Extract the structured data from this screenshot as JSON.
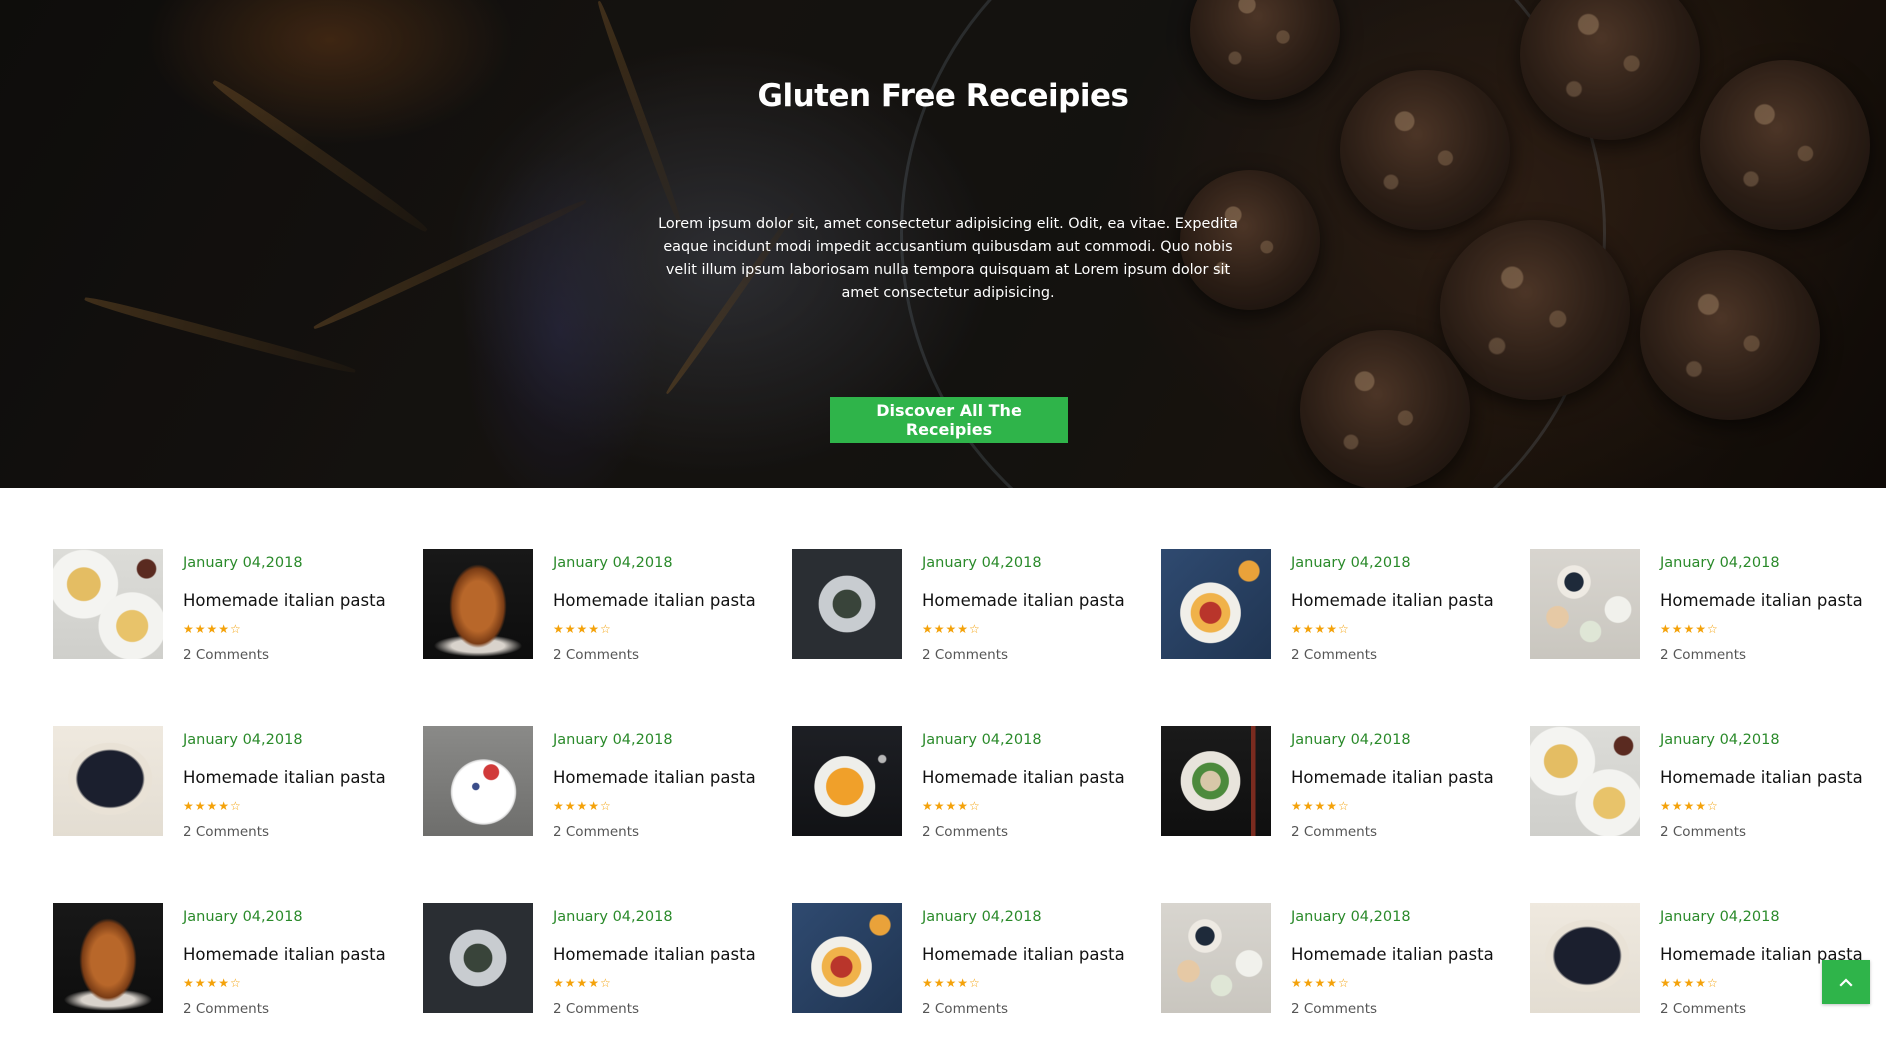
{
  "hero": {
    "title": "Gluten Free Receipies",
    "description": "Lorem ipsum dolor sit, amet consectetur adipisicing elit. Odit, ea vitae. Expedita eaque incidunt modi impedit accusantium quibusdam aut commodi. Quo nobis velit illum ipsum laboriosam nulla tempora quisquam at Lorem ipsum dolor sit amet consectetur adipisicing.",
    "button_label": "Discover All The Receipies"
  },
  "recipes": [
    {
      "date": "January 04,2018",
      "title": "Homemade italian pasta",
      "stars": "★★★★☆",
      "rating": 4,
      "comments": "2 Comments",
      "image": "pasta-plates"
    },
    {
      "date": "January 04,2018",
      "title": "Homemade italian pasta",
      "stars": "★★★★☆",
      "rating": 4,
      "comments": "2 Comments",
      "image": "panettone"
    },
    {
      "date": "January 04,2018",
      "title": "Homemade italian pasta",
      "stars": "★★★★☆",
      "rating": 4,
      "comments": "2 Comments",
      "image": "mussels"
    },
    {
      "date": "January 04,2018",
      "title": "Homemade italian pasta",
      "stars": "★★★★☆",
      "rating": 4,
      "comments": "2 Comments",
      "image": "fruit-bowl"
    },
    {
      "date": "January 04,2018",
      "title": "Homemade italian pasta",
      "stars": "★★★★☆",
      "rating": 4,
      "comments": "2 Comments",
      "image": "macarons"
    },
    {
      "date": "January 04,2018",
      "title": "Homemade italian pasta",
      "stars": "★★★★☆",
      "rating": 4,
      "comments": "2 Comments",
      "image": "blackberry-tart"
    },
    {
      "date": "January 04,2018",
      "title": "Homemade italian pasta",
      "stars": "★★★★☆",
      "rating": 4,
      "comments": "2 Comments",
      "image": "raspberry-plate"
    },
    {
      "date": "January 04,2018",
      "title": "Homemade italian pasta",
      "stars": "★★★★☆",
      "rating": 4,
      "comments": "2 Comments",
      "image": "peach-dessert"
    },
    {
      "date": "January 04,2018",
      "title": "Homemade italian pasta",
      "stars": "★★★★☆",
      "rating": 4,
      "comments": "2 Comments",
      "image": "noodle-soup"
    },
    {
      "date": "January 04,2018",
      "title": "Homemade italian pasta",
      "stars": "★★★★☆",
      "rating": 4,
      "comments": "2 Comments",
      "image": "pasta-plates"
    },
    {
      "date": "January 04,2018",
      "title": "Homemade italian pasta",
      "stars": "★★★★☆",
      "rating": 4,
      "comments": "2 Comments",
      "image": "panettone"
    },
    {
      "date": "January 04,2018",
      "title": "Homemade italian pasta",
      "stars": "★★★★☆",
      "rating": 4,
      "comments": "2 Comments",
      "image": "mussels"
    },
    {
      "date": "January 04,2018",
      "title": "Homemade italian pasta",
      "stars": "★★★★☆",
      "rating": 4,
      "comments": "2 Comments",
      "image": "fruit-bowl"
    },
    {
      "date": "January 04,2018",
      "title": "Homemade italian pasta",
      "stars": "★★★★☆",
      "rating": 4,
      "comments": "2 Comments",
      "image": "macarons"
    },
    {
      "date": "January 04,2018",
      "title": "Homemade italian pasta",
      "stars": "★★★★☆",
      "rating": 4,
      "comments": "2 Comments",
      "image": "blackberry-tart"
    }
  ],
  "scroll_top": {
    "icon": "chevron-up-icon"
  },
  "colors": {
    "accent": "#2fb44a",
    "date": "#2a8a2a",
    "stars": "#f4a20a",
    "title": "#111111",
    "comments": "#555555"
  }
}
